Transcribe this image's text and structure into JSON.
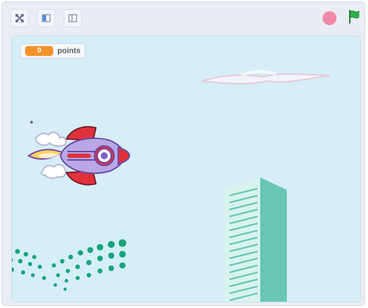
{
  "toolbar": {
    "fullscreen_icon": "fullscreen-icon",
    "small_stage_icon": "small-stage-icon",
    "normal_stage_icon": "normal-stage-icon",
    "stop_icon": "stop-icon",
    "green_flag_icon": "green-flag-icon"
  },
  "stage": {
    "score_monitor": {
      "value": "0",
      "label": "points"
    },
    "sprites": [
      "rocket",
      "cloud",
      "skyscraper",
      "dots"
    ]
  },
  "colors": {
    "stage_bg": "#d5eef7",
    "accent_orange": "#f3922b",
    "flag_green": "#2fb44a",
    "stop_pink": "#f08aa6"
  }
}
